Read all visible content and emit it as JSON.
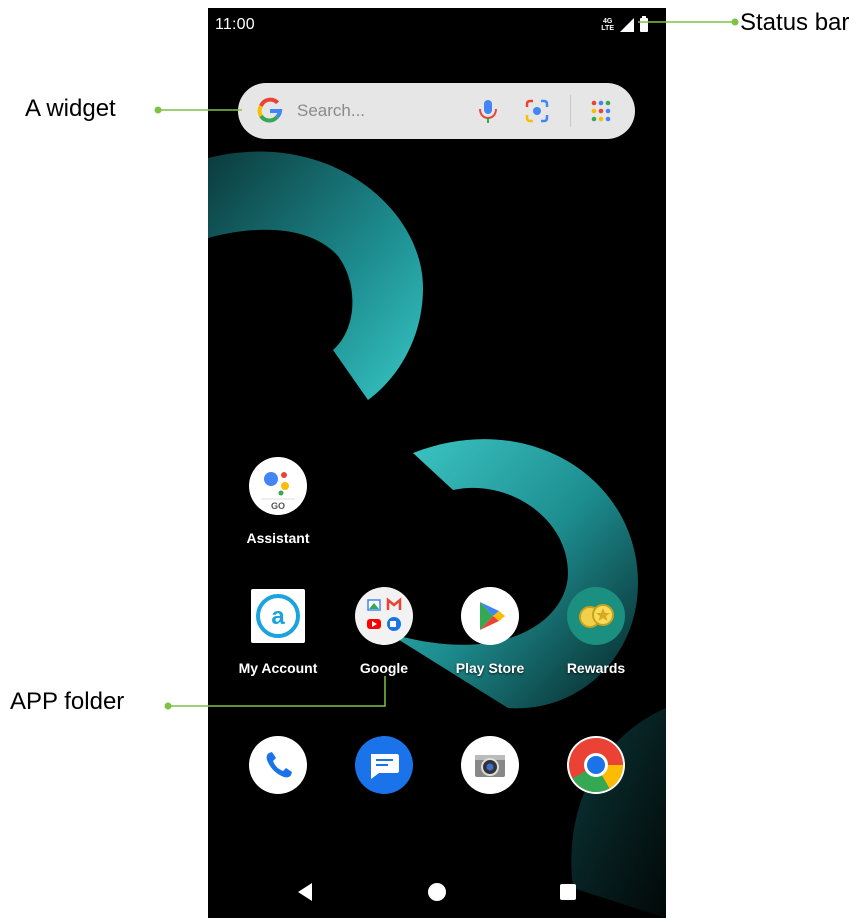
{
  "status_bar": {
    "time": "11:00",
    "network": [
      "4G",
      "LTE"
    ],
    "signal_icon": "signal-icon",
    "battery_icon": "battery-icon"
  },
  "search_widget": {
    "placeholder": "Search...",
    "icons": [
      "google-g-icon",
      "mic-icon",
      "lens-icon",
      "apps-grid-icon"
    ]
  },
  "apps": {
    "assistant": {
      "label": "Assistant",
      "badge": "GO"
    },
    "my_account": {
      "label": "My Account",
      "glyph": "a"
    },
    "google": {
      "label": "Google"
    },
    "play_store": {
      "label": "Play Store"
    },
    "rewards": {
      "label": "Rewards"
    }
  },
  "dock": [
    "phone-icon",
    "messages-icon",
    "camera-icon",
    "chrome-icon"
  ],
  "nav_bar": [
    "back-button",
    "home-button",
    "recents-button"
  ],
  "annotations": {
    "status_bar": "Status bar",
    "widget": "A widget",
    "app_folder": "APP folder"
  },
  "colors": {
    "callout_line": "#7dc242",
    "wallpaper_accent": "#2aa7a7",
    "background": "#000000"
  }
}
